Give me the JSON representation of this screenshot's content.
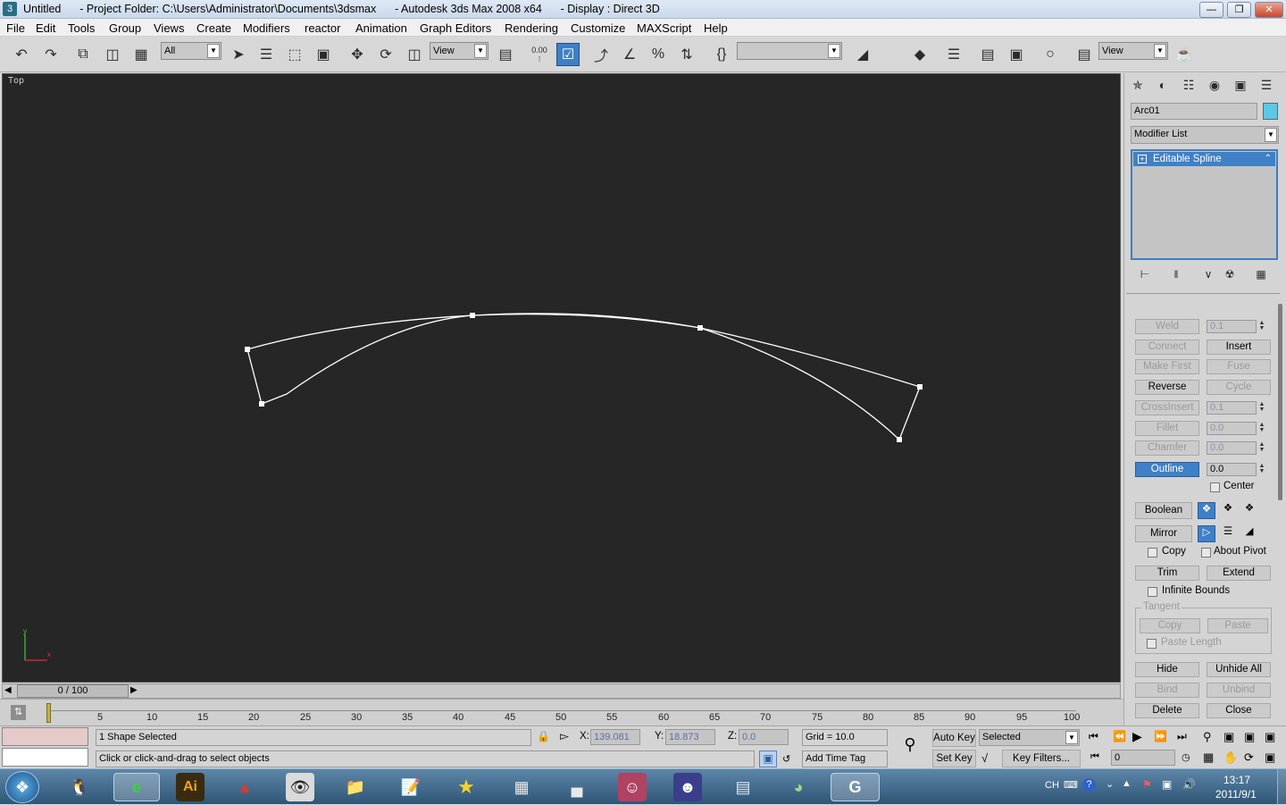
{
  "window": {
    "title": "Untitled      - Project Folder: C:\\Users\\Administrator\\Documents\\3dsmax      - Autodesk 3ds Max 2008 x64      - Display : Direct 3D",
    "min": "—",
    "max": "❐",
    "close": "✕"
  },
  "menu": [
    "File",
    "Edit",
    "Tools",
    "Group",
    "Views",
    "Create",
    "Modifiers",
    "reactor",
    "Animation",
    "Graph Editors",
    "Rendering",
    "Customize",
    "MAXScript",
    "Help"
  ],
  "toolbar": {
    "filter": "All",
    "refcoord": "View",
    "snaps": "0.00",
    "named_sel": "",
    "render_view": "View"
  },
  "viewport": {
    "label": "Top",
    "axis_y": "y",
    "axis_x": "x"
  },
  "cmd": {
    "object_name": "Arc01",
    "object_color": "#5ac8e6",
    "modifier_list": "Modifier List",
    "stack_item": "Editable Spline",
    "weld": "Weld",
    "weld_val": "0.1",
    "connect": "Connect",
    "insert": "Insert",
    "make_first": "Make First",
    "fuse": "Fuse",
    "reverse": "Reverse",
    "cycle": "Cycle",
    "crossinsert": "CrossInsert",
    "cross_val": "0.1",
    "fillet": "Fillet",
    "fillet_val": "0.0",
    "chamfer": "Chamfer",
    "chamfer_val": "0.0",
    "outline": "Outline",
    "outline_val": "0.0",
    "center": "Center",
    "boolean": "Boolean",
    "mirror": "Mirror",
    "copy": "Copy",
    "about_pivot": "About Pivot",
    "trim": "Trim",
    "extend": "Extend",
    "infinite_bounds": "Infinite Bounds",
    "tangent": "Tangent",
    "tan_copy": "Copy",
    "tan_paste": "Paste",
    "paste_length": "Paste Length",
    "hide": "Hide",
    "unhide_all": "Unhide All",
    "bind": "Bind",
    "unbind": "Unbind",
    "delete": "Delete",
    "close": "Close"
  },
  "timeslider": {
    "label": "0 / 100"
  },
  "ticks": [
    "5",
    "10",
    "15",
    "20",
    "25",
    "30",
    "35",
    "40",
    "45",
    "50",
    "55",
    "60",
    "65",
    "70",
    "75",
    "80",
    "85",
    "90",
    "95",
    "100"
  ],
  "status": {
    "selected": "1 Shape Selected",
    "prompt": "Click or click-and-drag to select objects",
    "x_label": "X:",
    "x": "139.081",
    "y_label": "Y:",
    "y": "18.873",
    "z_label": "Z:",
    "z": "0.0",
    "grid": "Grid = 10.0",
    "add_time_tag": "Add Time Tag",
    "auto_key": "Auto Key",
    "set_key": "Set Key",
    "sel_mode": "Selected",
    "key_filters": "Key Filters...",
    "frame": "0"
  },
  "taskbar": {
    "ime": "CH",
    "time": "13:17",
    "date": "2011/9/1",
    "apps": [
      "🐧",
      "e",
      "Ai",
      "▲",
      "👁",
      "📁",
      "📝",
      "★",
      "▦",
      "▄",
      "☺",
      "☻",
      "▤",
      "◕",
      "G"
    ]
  }
}
